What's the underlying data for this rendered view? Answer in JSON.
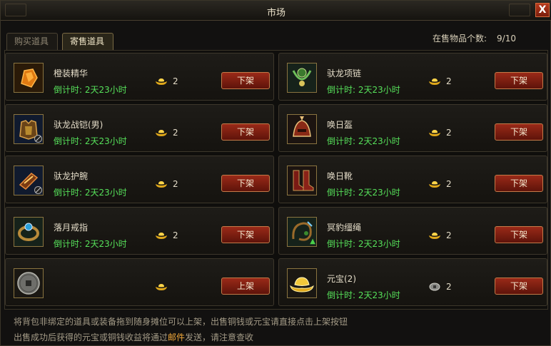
{
  "window": {
    "title": "市场",
    "close_label": "X"
  },
  "tabs": [
    {
      "label": "购买道具",
      "active": false
    },
    {
      "label": "寄售道具",
      "active": true
    }
  ],
  "stock": {
    "label": "在售物品个数:",
    "value": "9/10"
  },
  "slots": [
    {
      "name": "橙装精华",
      "timer": "倒计时: 2天23小时",
      "price": "2",
      "currency": "gold-ingot-icon",
      "button": "下架",
      "icon": "orange-gem-icon",
      "locked": false
    },
    {
      "name": "驮龙项链",
      "timer": "倒计时: 2天23小时",
      "price": "2",
      "currency": "gold-ingot-icon",
      "button": "下架",
      "icon": "necklace-icon",
      "locked": false
    },
    {
      "name": "驮龙战铠(男)",
      "timer": "倒计时: 2天23小时",
      "price": "2",
      "currency": "gold-ingot-icon",
      "button": "下架",
      "icon": "armor-icon",
      "locked": true
    },
    {
      "name": "唤日盔",
      "timer": "倒计时: 2天23小时",
      "price": "2",
      "currency": "gold-ingot-icon",
      "button": "下架",
      "icon": "helmet-icon",
      "locked": false
    },
    {
      "name": "驮龙护腕",
      "timer": "倒计时: 2天23小时",
      "price": "2",
      "currency": "gold-ingot-icon",
      "button": "下架",
      "icon": "bracer-icon",
      "locked": true
    },
    {
      "name": "唤日靴",
      "timer": "倒计时: 2天23小时",
      "price": "2",
      "currency": "gold-ingot-icon",
      "button": "下架",
      "icon": "boots-icon",
      "locked": false
    },
    {
      "name": "落月戒指",
      "timer": "倒计时: 2天23小时",
      "price": "2",
      "currency": "gold-ingot-icon",
      "button": "下架",
      "icon": "ring-icon",
      "locked": false
    },
    {
      "name": "冥豹缰绳",
      "timer": "倒计时: 2天23小时",
      "price": "2",
      "currency": "gold-ingot-icon",
      "button": "下架",
      "icon": "reins-icon",
      "locked": false,
      "upgrade": true
    },
    {
      "name": "",
      "timer": "",
      "price": "",
      "currency": "gold-ingot-icon",
      "button": "上架",
      "icon": "coin-icon",
      "locked": false
    },
    {
      "name": "元宝(2)",
      "timer": "倒计时: 2天23小时",
      "price": "2",
      "currency": "silver-coin-icon",
      "button": "下架",
      "icon": "gold-ingot-icon",
      "locked": false
    }
  ],
  "hints": {
    "line1": "将背包非绑定的道具或装备拖到随身摊位可以上架，出售铜钱或元宝请直接点击上架按钮",
    "line2_pre": "出售成功后获得的元宝或铜钱收益将通过",
    "line2_mail": "邮件",
    "line2_post": "发送，请注意查收"
  },
  "colors": {
    "timer": "#56e05a",
    "mail": "#f0a83a",
    "button": "#9a2a18"
  }
}
